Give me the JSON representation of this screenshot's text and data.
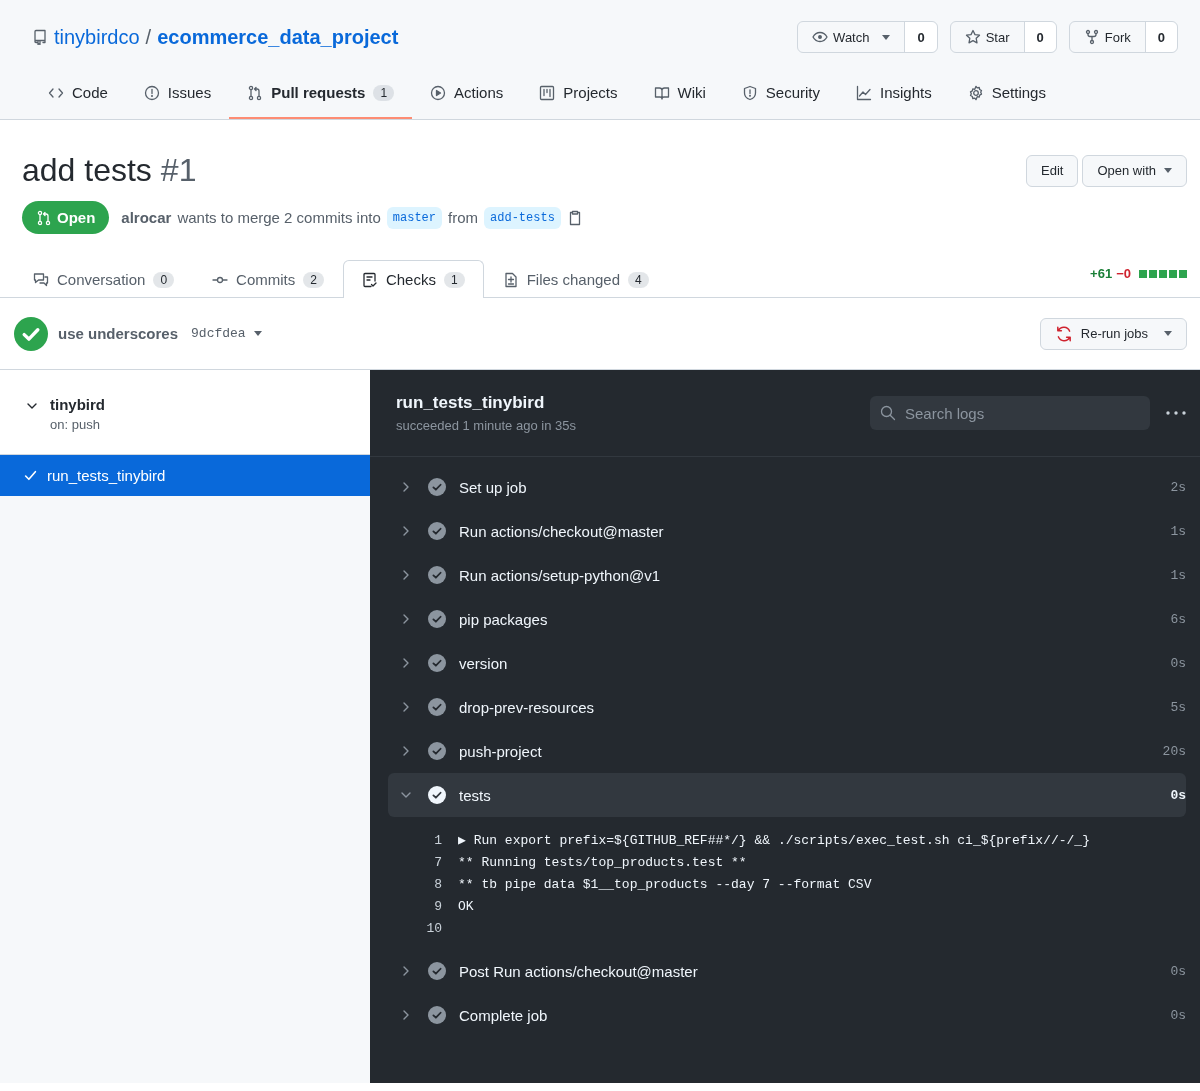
{
  "repo": {
    "owner": "tinybirdco",
    "separator": "/",
    "name": "ecommerce_data_project"
  },
  "repo_actions": [
    {
      "label": "Watch",
      "count": "0",
      "dropdown": true
    },
    {
      "label": "Star",
      "count": "0",
      "dropdown": false
    },
    {
      "label": "Fork",
      "count": "0",
      "dropdown": false
    }
  ],
  "nav": [
    {
      "label": "Code",
      "selected": false
    },
    {
      "label": "Issues",
      "selected": false
    },
    {
      "label": "Pull requests",
      "counter": "1",
      "selected": true
    },
    {
      "label": "Actions",
      "selected": false
    },
    {
      "label": "Projects",
      "selected": false
    },
    {
      "label": "Wiki",
      "selected": false
    },
    {
      "label": "Security",
      "selected": false
    },
    {
      "label": "Insights",
      "selected": false
    },
    {
      "label": "Settings",
      "selected": false
    }
  ],
  "pull_request": {
    "title": "add tests",
    "number": "#1",
    "buttons": [
      {
        "label": "Edit",
        "dropdown": false
      },
      {
        "label": "Open with",
        "dropdown": true
      }
    ],
    "state": "Open",
    "author": "alrocar",
    "merge_text": "wants to merge 2 commits into",
    "base_branch": "master",
    "connector": "from",
    "head_branch": "add-tests"
  },
  "pr_tabs": [
    {
      "label": "Conversation",
      "counter": "0",
      "selected": false
    },
    {
      "label": "Commits",
      "counter": "2",
      "selected": false
    },
    {
      "label": "Checks",
      "counter": "1",
      "selected": true
    },
    {
      "label": "Files changed",
      "counter": "4",
      "selected": false
    }
  ],
  "diffstat": {
    "additions": "+61",
    "deletions": "−0",
    "level": 1
  },
  "commit": {
    "message": "use underscores",
    "sha": "9dcfdea",
    "rerun_button": "Re-run jobs"
  },
  "sidebar": {
    "workflows": [
      {
        "name": "tinybird",
        "trigger": "on: push",
        "expanded": true,
        "jobs": [
          {
            "name": "run_tests_tinybird",
            "selected": true
          }
        ]
      }
    ]
  },
  "job": {
    "title": "run_tests_tinybird",
    "status": "succeeded 1 minute ago in 35s",
    "search": {
      "placeholder": "Search logs"
    },
    "steps": [
      {
        "name": "Set up job",
        "duration": "2s",
        "expanded": false
      },
      {
        "name": "Run actions/checkout@master",
        "duration": "1s",
        "expanded": false
      },
      {
        "name": "Run actions/setup-python@v1",
        "duration": "1s",
        "expanded": false
      },
      {
        "name": "pip packages",
        "duration": "6s",
        "expanded": false
      },
      {
        "name": "version",
        "duration": "0s",
        "expanded": false
      },
      {
        "name": "drop-prev-resources",
        "duration": "5s",
        "expanded": false
      },
      {
        "name": "push-project",
        "duration": "20s",
        "expanded": false
      },
      {
        "name": "tests",
        "duration": "0s",
        "expanded": true,
        "log": [
          {
            "line": "1",
            "text": "▶ Run export prefix=${GITHUB_REF##*/} && ./scripts/exec_test.sh ci_${prefix//-/_}"
          },
          {
            "line": "7",
            "text": "** Running tests/top_products.test **"
          },
          {
            "line": "8",
            "text": "** tb pipe data $1__top_products --day 7 --format CSV"
          },
          {
            "line": "9",
            "text": "OK"
          },
          {
            "line": "10"
          }
        ]
      },
      {
        "name": "Post Run actions/checkout@master",
        "duration": "0s",
        "expanded": false
      },
      {
        "name": "Complete job",
        "duration": "0s",
        "expanded": false
      }
    ]
  }
}
